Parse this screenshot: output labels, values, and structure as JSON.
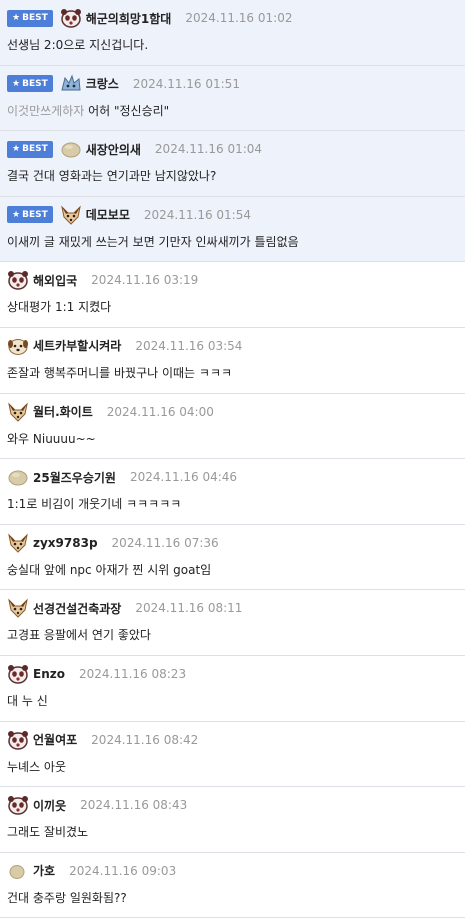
{
  "best_label": "BEST",
  "comments": [
    {
      "best": true,
      "avatar": "panda-avatar-icon",
      "nick": "해군의희망1함대",
      "time": "2024.11.16 01:02",
      "text": "선생님 2:0으로 지신겁니다."
    },
    {
      "best": true,
      "avatar": "blue-creature-avatar-icon",
      "nick": "크랑스",
      "time": "2024.11.16 01:51",
      "text_muted": "이것만쓰게하자",
      "text": " 어허 \"정신승리\""
    },
    {
      "best": true,
      "avatar": "round-blob-avatar-icon",
      "nick": "새장안의새",
      "time": "2024.11.16 01:04",
      "text": "결국 건대 영화과는 연기과만 남지않았나?"
    },
    {
      "best": true,
      "avatar": "fox-avatar-icon",
      "nick": "데모보모",
      "time": "2024.11.16 01:54",
      "text": "이새끼 글 재밌게 쓰는거 보면 기만자 인싸새끼가 틀림없음"
    },
    {
      "best": false,
      "avatar": "panda-avatar-icon",
      "nick": "해외입국",
      "time": "2024.11.16 03:19",
      "text": "상대평가 1:1 지켰다"
    },
    {
      "best": false,
      "avatar": "dog-avatar-icon",
      "nick": "세트카부할시켜라",
      "time": "2024.11.16 03:54",
      "text": "존잘과 행복주머니를 바꿨구나 이때는 ㅋㅋㅋ"
    },
    {
      "best": false,
      "avatar": "fox-avatar-icon",
      "nick": "월터.화이트",
      "time": "2024.11.16 04:00",
      "text": "와우 Niuuuu~~"
    },
    {
      "best": false,
      "avatar": "round-blob-avatar-icon",
      "nick": "25월즈우승기원",
      "time": "2024.11.16 04:46",
      "text": "1:1로 비김이 개웃기네 ㅋㅋㅋㅋㅋ"
    },
    {
      "best": false,
      "avatar": "fox-avatar-icon",
      "nick": "zyx9783p",
      "time": "2024.11.16 07:36",
      "text": "숭실대 앞에 npc 아재가 찐 시위 goat임"
    },
    {
      "best": false,
      "avatar": "fox-avatar-icon",
      "nick": "선경건설건축과장",
      "time": "2024.11.16 08:11",
      "text": "고경표 응팔에서 연기 좋았다"
    },
    {
      "best": false,
      "avatar": "panda-avatar-icon",
      "nick": "Enzo",
      "time": "2024.11.16 08:23",
      "text": "대 누 신"
    },
    {
      "best": false,
      "avatar": "panda-avatar-icon",
      "nick": "언월여포",
      "time": "2024.11.16 08:42",
      "text": "누녜스 아웃"
    },
    {
      "best": false,
      "avatar": "panda-avatar-icon",
      "nick": "이끼읏",
      "time": "2024.11.16 08:43",
      "text": "그래도 잘비겼노"
    },
    {
      "best": false,
      "avatar": "small-blob-avatar-icon",
      "nick": "가호",
      "time": "2024.11.16 09:03",
      "text": "건대 충주랑 일원화됨??"
    }
  ]
}
